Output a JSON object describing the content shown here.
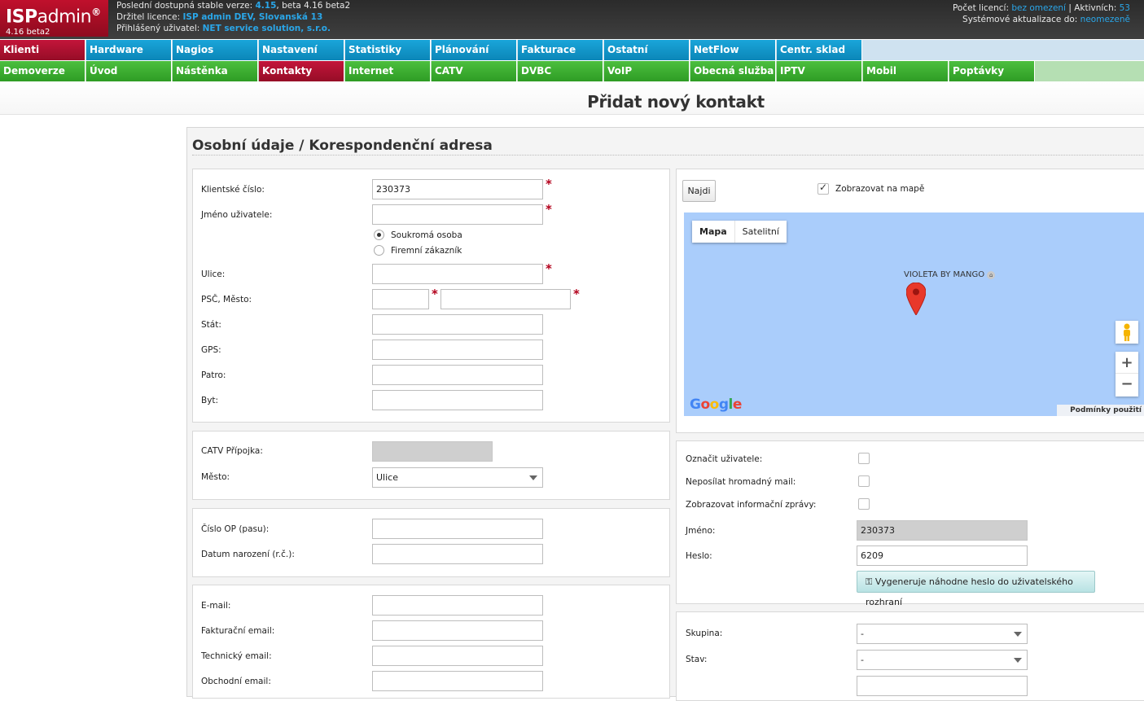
{
  "header": {
    "brand_bold": "ISP",
    "brand_thin": "admin",
    "brand_reg": "®",
    "version": "4.16 beta2",
    "info": {
      "stable_prefix": "Poslední dostupná stable verze:",
      "stable_version": "4.15",
      "beta_text": ", beta 4.16 beta2",
      "license_holder_label": "Držitel licence:",
      "license_holder": "ISP admin DEV, Slovanská 13",
      "logged_user_label": "Přihlášený uživatel:",
      "logged_user": "NET service solution, s.r.o."
    },
    "right": {
      "licenses_label": "Počet licencí:",
      "licenses_value": "bez omezení",
      "separator": "|",
      "active_label": "Aktivních:",
      "active_value": "53",
      "updates_label": "Systémové aktualizace do:",
      "updates_value": "neomezeně"
    }
  },
  "nav_top": [
    "Klienti",
    "Hardware",
    "Nagios",
    "Nastavení",
    "Statistiky",
    "Plánování",
    "Fakturace",
    "Ostatní",
    "NetFlow",
    "Centr. sklad"
  ],
  "nav_sub": [
    "Demoverze",
    "Úvod",
    "Nástěnka",
    "Kontakty",
    "Internet",
    "CATV",
    "DVBC",
    "VoIP",
    "Obecná služba",
    "IPTV",
    "Mobil",
    "Poptávky"
  ],
  "page": {
    "title": "Přidat nový kontakt",
    "section_title": "Osobní údaje / Korespondenční adresa"
  },
  "personal": {
    "client_number_label": "Klientské číslo:",
    "client_number_value": "230373",
    "username_label": "Jméno uživatele:",
    "radio_private": "Soukromá osoba",
    "radio_company": "Firemní zákazník",
    "street_label": "Ulice:",
    "zip_city_label": "PSČ, Město:",
    "state_label": "Stát:",
    "gps_label": "GPS:",
    "floor_label": "Patro:",
    "flat_label": "Byt:",
    "required_mark": "*"
  },
  "catv": {
    "connection_label": "CATV Přípojka:",
    "city_label": "Město:",
    "city_value": "Ulice"
  },
  "identity": {
    "id_label": "Číslo OP (pasu):",
    "birth_label": "Datum narození (r.č.):"
  },
  "emails": {
    "email_label": "E-mail:",
    "billing_email_label": "Fakturační email:",
    "tech_email_label": "Technický email:",
    "sales_email_label": "Obchodní email:"
  },
  "map": {
    "find_button": "Najdi",
    "show_on_map_label": "Zobrazovat na mapě",
    "show_on_map_checked": true,
    "type_map": "Mapa",
    "type_satellite": "Satelitní",
    "place_label": "VIOLETA BY MANGO",
    "google_logo": "Google",
    "terms": "Podmínky použití",
    "zoom_in": "+",
    "zoom_out": "−"
  },
  "account": {
    "mark_user_label": "Označit uživatele:",
    "no_bulk_mail_label": "Neposílat hromadný mail:",
    "show_info_label": "Zobrazovat informační zprávy:",
    "name_label": "Jméno:",
    "name_value": "230373",
    "password_label": "Heslo:",
    "password_value": "6209",
    "generate_button": "Vygeneruje náhodne heslo do uživatelského rozhraní"
  },
  "group": {
    "group_label": "Skupina:",
    "group_value": "-",
    "state_label": "Stav:",
    "state_value": "-"
  },
  "colors": {
    "brand_red": "#c0102c",
    "nav_blue": "#1aa5d9",
    "nav_green": "#4cbf3f",
    "link_blue": "#2aa6e8",
    "map_water": "#aacdfb"
  }
}
